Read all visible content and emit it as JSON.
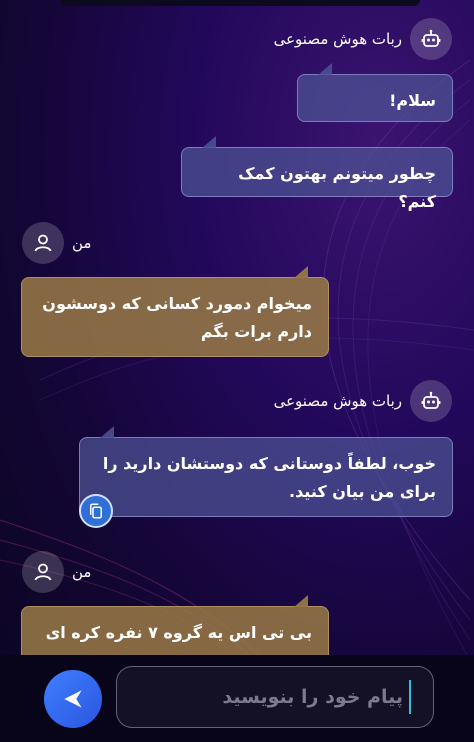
{
  "chat": {
    "bot_name": "ربات هوش مصنوعی",
    "user_name": "من",
    "messages": [
      {
        "sender": "bot",
        "text": "سلام!"
      },
      {
        "sender": "bot",
        "text": "چطور میتونم بهتون کمک کنم؟"
      },
      {
        "sender": "user",
        "text": "میخوام دمورد کسانی که دوسشون دارم برات بگم"
      },
      {
        "sender": "bot",
        "text": "خوب، لطفاً دوستانی که دوستشان دارید را برای من بیان کنید."
      },
      {
        "sender": "user",
        "text": "بی تی اس یه گروه ۷ نفره کره ای"
      }
    ]
  },
  "icons": {
    "bot_avatar": "robot-icon",
    "user_avatar": "user-icon",
    "copy": "copy-icon",
    "send": "send-icon"
  },
  "composer": {
    "placeholder": "پیام خود را بنویسید"
  },
  "colors": {
    "accent": "#2f6fd6",
    "user_bubble": "#967846",
    "bot_bubble": "#4e5496",
    "caret": "#2fc0d8"
  }
}
